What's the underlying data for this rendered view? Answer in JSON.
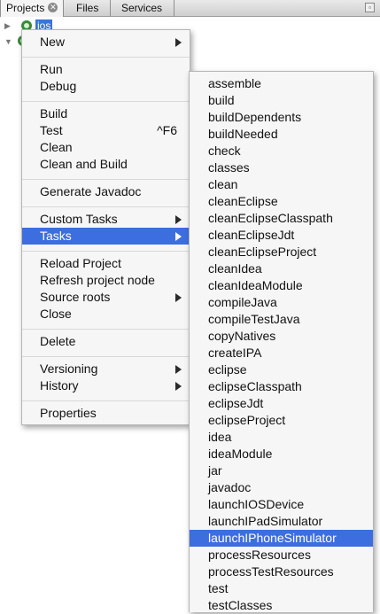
{
  "tabs": [
    {
      "label": "Projects",
      "active": true
    },
    {
      "label": "Files",
      "active": false
    },
    {
      "label": "Services",
      "active": false
    }
  ],
  "tree": {
    "project_label": "ios"
  },
  "context_menu": {
    "new": "New",
    "run": "Run",
    "debug": "Debug",
    "build": "Build",
    "test": "Test",
    "test_shortcut": "^F6",
    "clean": "Clean",
    "clean_and_build": "Clean and Build",
    "generate_javadoc": "Generate Javadoc",
    "custom_tasks": "Custom Tasks",
    "tasks": "Tasks",
    "reload_project": "Reload Project",
    "refresh_project_node": "Refresh project node",
    "source_roots": "Source roots",
    "close": "Close",
    "delete": "Delete",
    "versioning": "Versioning",
    "history": "History",
    "properties": "Properties"
  },
  "tasks_submenu": [
    "assemble",
    "build",
    "buildDependents",
    "buildNeeded",
    "check",
    "classes",
    "clean",
    "cleanEclipse",
    "cleanEclipseClasspath",
    "cleanEclipseJdt",
    "cleanEclipseProject",
    "cleanIdea",
    "cleanIdeaModule",
    "compileJava",
    "compileTestJava",
    "copyNatives",
    "createIPA",
    "eclipse",
    "eclipseClasspath",
    "eclipseJdt",
    "eclipseProject",
    "idea",
    "ideaModule",
    "jar",
    "javadoc",
    "launchIOSDevice",
    "launchIPadSimulator",
    "launchIPhoneSimulator",
    "processResources",
    "processTestResources",
    "test",
    "testClasses"
  ],
  "selected_task": "launchIPhoneSimulator",
  "colors": {
    "selection": "#3d6ee0",
    "menu_bg": "#f6f6f6"
  }
}
